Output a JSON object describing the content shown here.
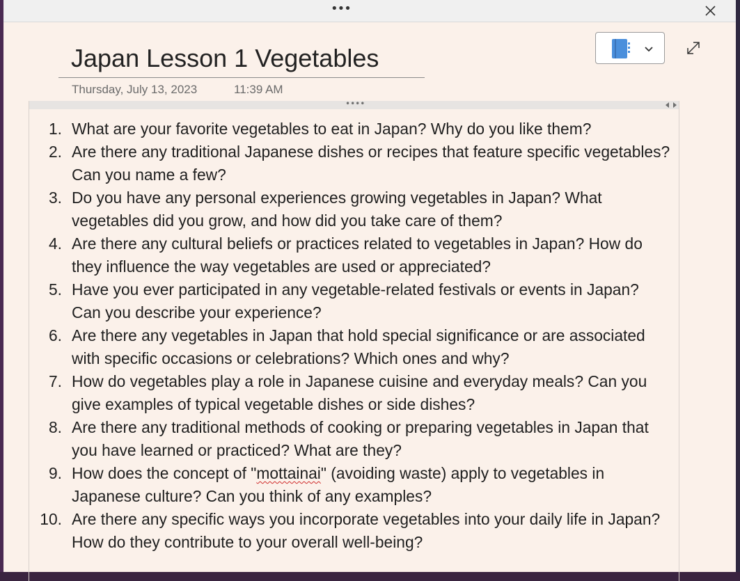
{
  "titlebar": {
    "more_label": "•••",
    "close_icon": "close-icon"
  },
  "toolbar": {
    "notebook_icon": "notebook-icon",
    "dropdown_icon": "chevron-down-icon",
    "expand_icon": "expand-icon",
    "accent": "#4a8fdc"
  },
  "page": {
    "title": "Japan Lesson 1 Vegetables",
    "date": "Thursday, July 13, 2023",
    "time": "11:39 AM"
  },
  "container": {
    "handle_dots": "••••"
  },
  "questions": [
    {
      "num": "1.",
      "parts": [
        "What are your favorite vegetables to eat in Japan? Why do you like them?"
      ]
    },
    {
      "num": "2.",
      "parts": [
        "Are there any traditional Japanese dishes or recipes that feature specific vegetables? Can you name a few?"
      ]
    },
    {
      "num": "3.",
      "parts": [
        "Do you have any personal experiences growing vegetables in Japan? What vegetables did you grow, and how did you take care of them?"
      ]
    },
    {
      "num": "4.",
      "parts": [
        "Are there any cultural beliefs or practices related to vegetables in Japan? How do they influence the way vegetables are used or appreciated?"
      ]
    },
    {
      "num": "5.",
      "parts": [
        "Have you ever participated in any vegetable-related festivals or events in Japan? Can you describe your experience?"
      ]
    },
    {
      "num": "6.",
      "parts": [
        "Are there any vegetables in Japan that hold special significance or are associated with specific occasions or celebrations? Which ones and why?"
      ]
    },
    {
      "num": "7.",
      "parts": [
        "How do vegetables play a role in Japanese cuisine and everyday meals? Can you give examples of typical vegetable dishes or side dishes?"
      ]
    },
    {
      "num": "8.",
      "parts": [
        "Are there any traditional methods of cooking or preparing vegetables in Japan that you have learned or practiced? What are they?"
      ]
    },
    {
      "num": "9.",
      "parts": [
        "How does the concept of \"",
        "mottainai",
        "\" (avoiding waste) apply to vegetables in Japanese culture? Can you think of any examples?"
      ]
    },
    {
      "num": "10.",
      "parts": [
        "Are there any specific ways you incorporate vegetables into your daily life in Japan? How do they contribute to your overall well-being?"
      ]
    }
  ]
}
